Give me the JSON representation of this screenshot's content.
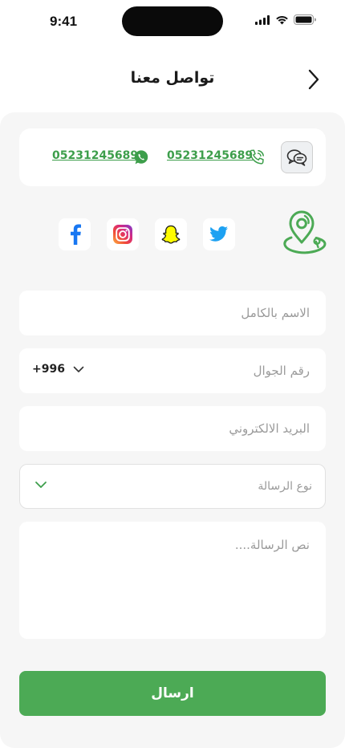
{
  "status_bar": {
    "time": "9:41"
  },
  "header": {
    "title": "تواصل معنا",
    "back_icon": "chevron-right-icon"
  },
  "contact": {
    "phone_number": "05231245689",
    "whatsapp_number": "05231245689",
    "chat_icon": "chat-bubbles-icon",
    "phone_icon": "phone-call-icon",
    "whatsapp_icon": "whatsapp-icon",
    "accent_color": "#3d9e4b"
  },
  "social": {
    "items": [
      {
        "name": "twitter",
        "icon": "twitter-icon",
        "color": "#1da1f2"
      },
      {
        "name": "snapchat",
        "icon": "snapchat-icon",
        "color": "#fffc00"
      },
      {
        "name": "instagram",
        "icon": "instagram-icon",
        "color": "#e1306c"
      },
      {
        "name": "facebook",
        "icon": "facebook-icon",
        "color": "#1877f2"
      }
    ]
  },
  "form": {
    "name_placeholder": "الاسم بالكامل",
    "phone_placeholder": "رقم الجوال",
    "country_code": "+996",
    "email_placeholder": "البريد الالكتروني",
    "message_type_placeholder": "نوع الرسالة",
    "message_placeholder": "نص الرسالة....",
    "submit_label": "ارسال",
    "submit_color": "#4caa55"
  }
}
